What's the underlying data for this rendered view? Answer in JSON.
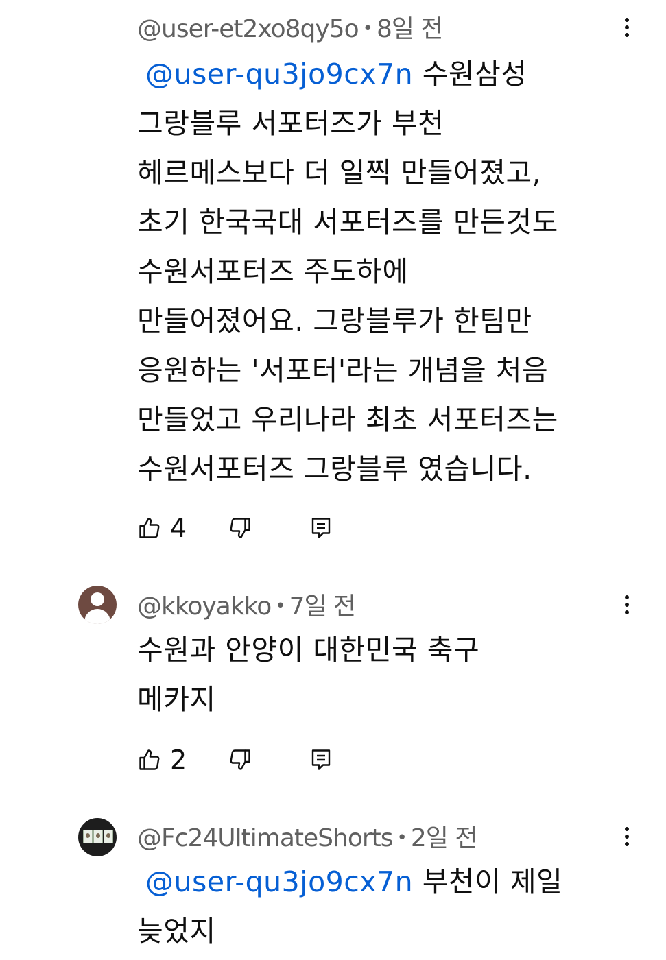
{
  "comments": [
    {
      "author": "@user-et2xo8qy5o",
      "separator": "•",
      "time": "8일 전",
      "mention": "@user-qu3jo9cx7n",
      "text": "수원삼성\n그랑블루 서포터즈가 부천\n헤르메스보다 더 일찍 만들어졌고,\n초기 한국국대 서포터즈를 만든것도\n수원서포터즈 주도하에\n만들어졌어요. 그랑블루가 한팀만\n응원하는 '서포터'라는 개념을 처음\n만들었고 우리나라 최초 서포터즈는\n수원서포터즈 그랑블루 였습니다.",
      "likes": "4",
      "avatar_icon": "none"
    },
    {
      "author": "@kkoyakko",
      "separator": "•",
      "time": "7일 전",
      "mention": "",
      "text": "수원과 안양이 대한민국 축구\n메카지",
      "likes": "2",
      "avatar_icon": "default-person-avatar"
    },
    {
      "author": "@Fc24UltimateShorts",
      "separator": "•",
      "time": "2일 전",
      "mention": "@user-qu3jo9cx7n",
      "text": "부천이 제일\n늦었지",
      "likes": "",
      "avatar_icon": "cards-avatar"
    }
  ],
  "icons": {
    "like": "thumbs-up-icon",
    "dislike": "thumbs-down-icon",
    "reply": "reply-icon",
    "menu": "more-vert-icon"
  },
  "colors": {
    "text": "#0f0f0f",
    "meta": "#606060",
    "mention": "#065fd4",
    "background": "#ffffff"
  }
}
